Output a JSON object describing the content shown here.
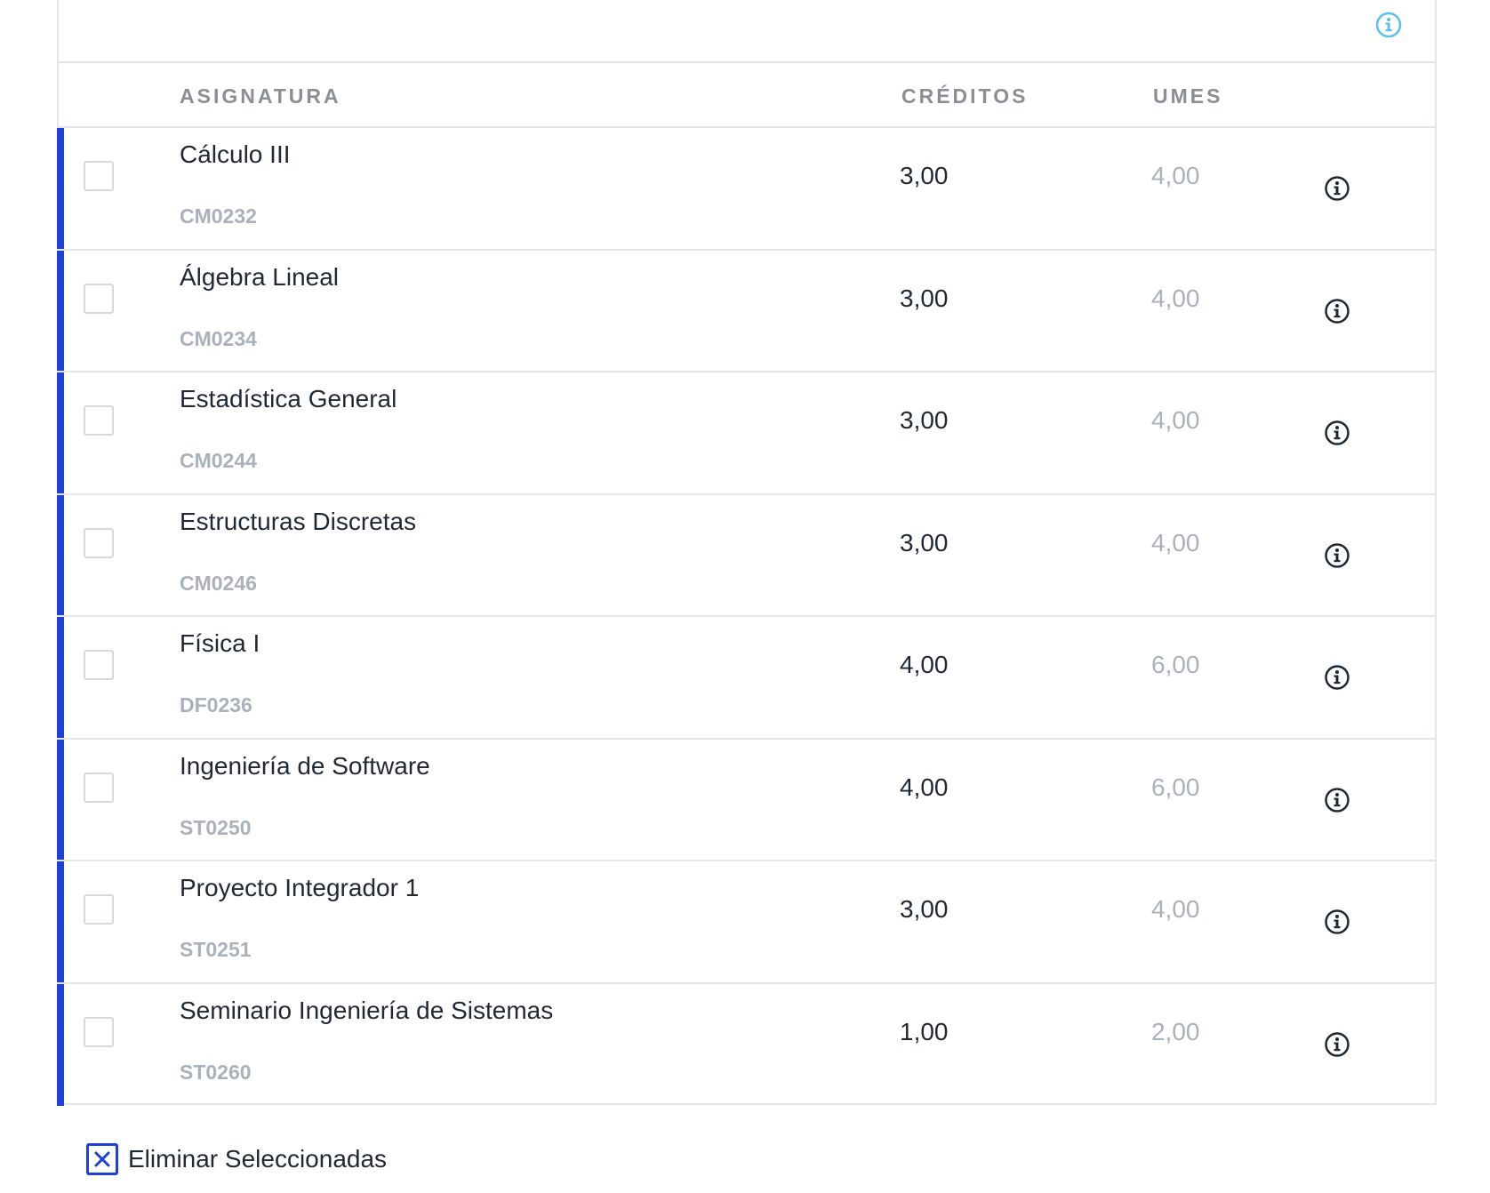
{
  "table": {
    "headers": {
      "course": "ASIGNATURA",
      "credits": "CRÉDITOS",
      "umes": "UMES"
    },
    "rows": [
      {
        "name": "Cálculo III",
        "code": "CM0232",
        "credits": "3,00",
        "umes": "4,00"
      },
      {
        "name": "Álgebra Lineal",
        "code": "CM0234",
        "credits": "3,00",
        "umes": "4,00"
      },
      {
        "name": "Estadística General",
        "code": "CM0244",
        "credits": "3,00",
        "umes": "4,00"
      },
      {
        "name": "Estructuras Discretas",
        "code": "CM0246",
        "credits": "3,00",
        "umes": "4,00"
      },
      {
        "name": "Física I",
        "code": "DF0236",
        "credits": "4,00",
        "umes": "6,00"
      },
      {
        "name": "Ingeniería de Software",
        "code": "ST0250",
        "credits": "4,00",
        "umes": "6,00"
      },
      {
        "name": "Proyecto Integrador 1",
        "code": "ST0251",
        "credits": "3,00",
        "umes": "4,00"
      },
      {
        "name": "Seminario Ingeniería de Sistemas",
        "code": "ST0260",
        "credits": "1,00",
        "umes": "2,00"
      }
    ]
  },
  "actions": {
    "delete_selected": "Eliminar Seleccionadas"
  },
  "colors": {
    "accent": "#1e3fd8",
    "info_top": "#5bc0ea",
    "muted_text": "#a9b1bb",
    "header_text": "#8a8f96",
    "border": "#e3e7ec"
  },
  "icons": {
    "top": "info-icon",
    "row": "info-icon",
    "delete": "close-box-icon"
  }
}
